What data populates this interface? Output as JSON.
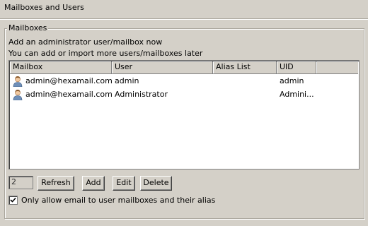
{
  "page": {
    "title": "Mailboxes and Users"
  },
  "group": {
    "label": "Mailboxes",
    "info_line1": "Add an administrator user/mailbox now",
    "info_line2": "You can add or import more users/mailboxes later"
  },
  "table": {
    "columns": [
      "Mailbox",
      "User",
      "Alias List",
      "UID"
    ],
    "rows": [
      {
        "icon": "user-icon",
        "mailbox": "admin@hexamail.com",
        "user": "admin",
        "alias": "",
        "uid": "admin"
      },
      {
        "icon": "user-icon",
        "mailbox": "admin@hexamail.com",
        "user": "Administrator",
        "alias": "",
        "uid": "Admini..."
      }
    ]
  },
  "toolbar": {
    "count": "2",
    "refresh_label": "Refresh",
    "add_label": "Add",
    "edit_label": "Edit",
    "delete_label": "Delete"
  },
  "options": {
    "only_allow_label": "Only allow email to user mailboxes and their alias",
    "only_allow_checked": true
  }
}
